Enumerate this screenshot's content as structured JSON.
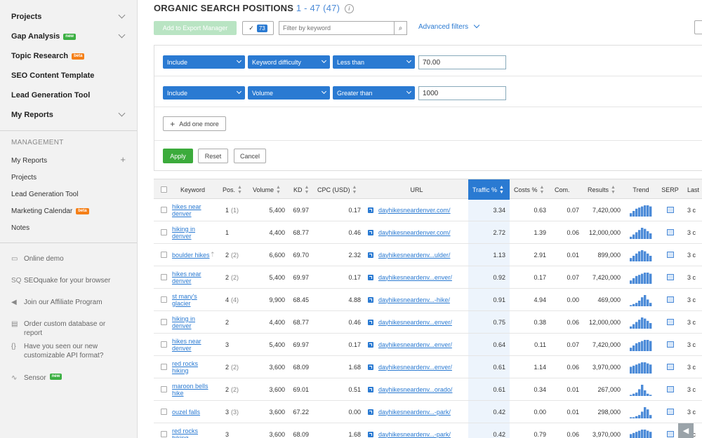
{
  "sidebar": {
    "nav": [
      {
        "label": "Projects",
        "badge": "",
        "chevron": true
      },
      {
        "label": "Gap Analysis",
        "badge": "new",
        "chevron": true
      },
      {
        "label": "Topic Research",
        "badge": "beta",
        "chevron": false
      },
      {
        "label": "SEO Content Template",
        "badge": "",
        "chevron": false
      },
      {
        "label": "Lead Generation Tool",
        "badge": "",
        "chevron": false
      },
      {
        "label": "My Reports",
        "badge": "",
        "chevron": true
      }
    ],
    "management_heading": "MANAGEMENT",
    "management": [
      {
        "label": "My Reports",
        "badge": "",
        "plus": true
      },
      {
        "label": "Projects",
        "badge": "",
        "plus": false
      },
      {
        "label": "Lead Generation Tool",
        "badge": "",
        "plus": false
      },
      {
        "label": "Marketing Calendar",
        "badge": "beta",
        "plus": false
      },
      {
        "label": "Notes",
        "badge": "",
        "plus": false
      }
    ],
    "tools": [
      {
        "icon": "monitor-icon",
        "glyph": "▭",
        "label": "Online demo"
      },
      {
        "icon": "seoquake-icon",
        "glyph": "SQ",
        "label": "SEOquake for your browser"
      },
      {
        "icon": "megaphone-icon",
        "glyph": "◀",
        "label": "Join our Affiliate Program"
      },
      {
        "icon": "document-icon",
        "glyph": "▤",
        "label": "Order custom database or report"
      },
      {
        "icon": "braces-icon",
        "glyph": "{}",
        "label": "Have you seen our new customizable API format?"
      },
      {
        "icon": "pulse-icon",
        "glyph": "∿",
        "label": "Sensor",
        "badge": "new"
      }
    ]
  },
  "header": {
    "title": "ORGANIC SEARCH POSITIONS",
    "count": "1 - 47 (47)",
    "info_glyph": "i"
  },
  "toolbar": {
    "export_label": "Add to Export Manager",
    "selected_count": "73",
    "filter_placeholder": "Filter by keyword",
    "advanced_filters": "Advanced filters"
  },
  "filters": [
    {
      "mode": "Include",
      "field": "Keyword difficulty",
      "op": "Less than",
      "value": "70.00"
    },
    {
      "mode": "Include",
      "field": "Volume",
      "op": "Greater than",
      "value": "1000"
    }
  ],
  "filter_actions": {
    "add_more": "Add one more",
    "apply": "Apply",
    "reset": "Reset",
    "cancel": "Cancel"
  },
  "table": {
    "columns": [
      "Keyword",
      "Pos.",
      "Volume",
      "KD",
      "CPC (USD)",
      "URL",
      "Traffic %",
      "Costs %",
      "Com.",
      "Results",
      "Trend",
      "SERP",
      "Last"
    ],
    "rows": [
      {
        "keyword": "hikes near denver",
        "pos": "1",
        "prev": "(1)",
        "volume": "5,400",
        "kd": "69.97",
        "cpc": "0.17",
        "url": "dayhikesneardenver.com/",
        "traffic": "3.34",
        "costs": "0.63",
        "com": "0.07",
        "results": "7,420,000",
        "trend": [
          3,
          5,
          7,
          8,
          9,
          10,
          10,
          9
        ],
        "last": "3 c",
        "up": false
      },
      {
        "keyword": "hiking in denver",
        "pos": "1",
        "prev": "",
        "volume": "4,400",
        "kd": "68.77",
        "cpc": "0.46",
        "url": "dayhikesneardenver.com/",
        "traffic": "2.72",
        "costs": "1.39",
        "com": "0.06",
        "results": "12,000,000",
        "trend": [
          2,
          4,
          6,
          8,
          10,
          9,
          7,
          5
        ],
        "last": "3 c",
        "up": false
      },
      {
        "keyword": "boulder hikes",
        "pos": "2",
        "prev": "(2)",
        "volume": "6,600",
        "kd": "69.70",
        "cpc": "2.32",
        "url": "dayhikesneardenv...ulder/",
        "traffic": "1.13",
        "costs": "2.91",
        "com": "0.01",
        "results": "899,000",
        "trend": [
          3,
          5,
          7,
          9,
          10,
          9,
          7,
          5
        ],
        "last": "3 c",
        "up": true
      },
      {
        "keyword": "hikes near denver",
        "pos": "2",
        "prev": "(2)",
        "volume": "5,400",
        "kd": "69.97",
        "cpc": "0.17",
        "url": "dayhikesneardenv...enver/",
        "traffic": "0.92",
        "costs": "0.17",
        "com": "0.07",
        "results": "7,420,000",
        "trend": [
          3,
          5,
          7,
          8,
          9,
          10,
          10,
          9
        ],
        "last": "3 c",
        "up": false
      },
      {
        "keyword": "st mary's glacier",
        "pos": "4",
        "prev": "(4)",
        "volume": "9,900",
        "kd": "68.45",
        "cpc": "4.88",
        "url": "dayhikesneardenv...-hike/",
        "traffic": "0.91",
        "costs": "4.94",
        "com": "0.00",
        "results": "469,000",
        "trend": [
          1,
          2,
          3,
          5,
          8,
          10,
          6,
          3
        ],
        "last": "3 c",
        "up": false
      },
      {
        "keyword": "hiking in denver",
        "pos": "2",
        "prev": "",
        "volume": "4,400",
        "kd": "68.77",
        "cpc": "0.46",
        "url": "dayhikesneardenv...enver/",
        "traffic": "0.75",
        "costs": "0.38",
        "com": "0.06",
        "results": "12,000,000",
        "trend": [
          2,
          4,
          6,
          8,
          10,
          9,
          7,
          5
        ],
        "last": "3 c",
        "up": false
      },
      {
        "keyword": "hikes near denver",
        "pos": "3",
        "prev": "",
        "volume": "5,400",
        "kd": "69.97",
        "cpc": "0.17",
        "url": "dayhikesneardenv...enver/",
        "traffic": "0.64",
        "costs": "0.11",
        "com": "0.07",
        "results": "7,420,000",
        "trend": [
          3,
          5,
          7,
          8,
          9,
          10,
          10,
          9
        ],
        "last": "3 c",
        "up": false
      },
      {
        "keyword": "red rocks hiking",
        "pos": "2",
        "prev": "(2)",
        "volume": "3,600",
        "kd": "68.09",
        "cpc": "1.68",
        "url": "dayhikesneardenv...enver/",
        "traffic": "0.61",
        "costs": "1.14",
        "com": "0.06",
        "results": "3,970,000",
        "trend": [
          6,
          7,
          8,
          9,
          10,
          10,
          9,
          8
        ],
        "last": "3 c",
        "up": false
      },
      {
        "keyword": "maroon bells hike",
        "pos": "2",
        "prev": "(2)",
        "volume": "3,600",
        "kd": "69.01",
        "cpc": "0.51",
        "url": "dayhikesneardenv...orado/",
        "traffic": "0.61",
        "costs": "0.34",
        "com": "0.01",
        "results": "267,000",
        "trend": [
          1,
          2,
          3,
          6,
          10,
          5,
          2,
          1
        ],
        "last": "3 c",
        "up": false
      },
      {
        "keyword": "ouzel falls",
        "pos": "3",
        "prev": "(3)",
        "volume": "3,600",
        "kd": "67.22",
        "cpc": "0.00",
        "url": "dayhikesneardenv...-park/",
        "traffic": "0.42",
        "costs": "0.00",
        "com": "0.01",
        "results": "298,000",
        "trend": [
          1,
          1,
          2,
          3,
          6,
          10,
          8,
          3
        ],
        "last": "3 c",
        "up": false
      },
      {
        "keyword": "red rocks hiking",
        "pos": "3",
        "prev": "",
        "volume": "3,600",
        "kd": "68.09",
        "cpc": "1.68",
        "url": "dayhikesneardenv...-park/",
        "traffic": "0.42",
        "costs": "0.79",
        "com": "0.06",
        "results": "3,970,000",
        "trend": [
          6,
          7,
          8,
          9,
          10,
          10,
          9,
          8
        ],
        "last": "3 c",
        "up": false
      }
    ]
  },
  "colors": {
    "accent": "#2a7ad2",
    "apply": "#3cab3c",
    "new_badge": "#3cb043",
    "beta_badge": "#f57f17",
    "trend_bar": "#4c8bd8"
  }
}
